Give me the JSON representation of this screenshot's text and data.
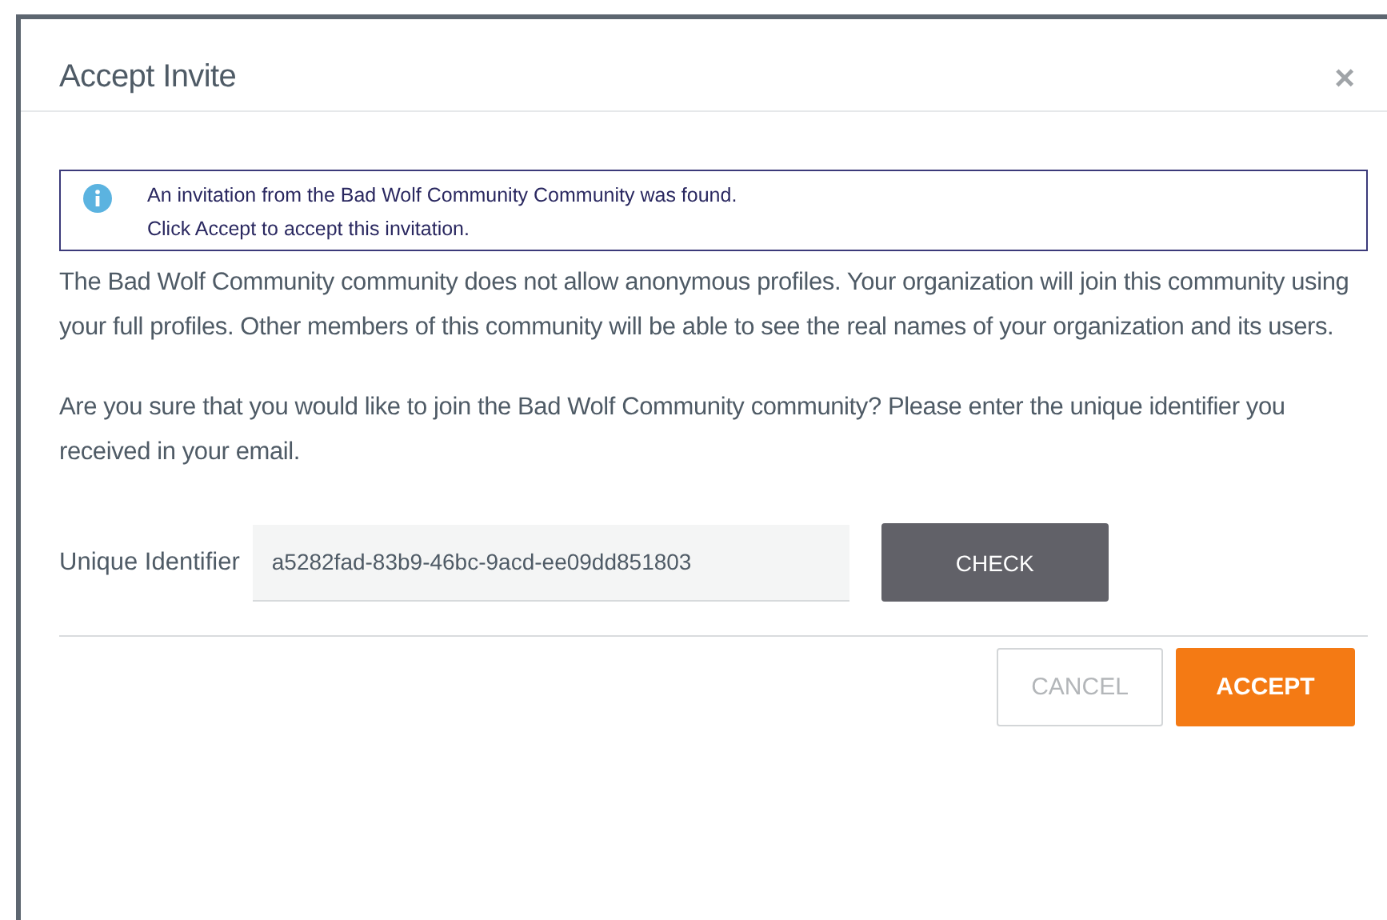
{
  "dialog": {
    "title": "Accept Invite",
    "close": "×"
  },
  "alert": {
    "lines": [
      "An invitation from the Bad Wolf Community Community was found.",
      "Click Accept to accept this invitation."
    ]
  },
  "paragraphs": [
    "The Bad Wolf Community community does not allow anonymous profiles. Your organization will join this community using your full profiles. Other members of this community will be able to see the real names of your organization and its users.",
    "Are you sure that you would like to join the Bad Wolf Community community? Please enter the unique identifier you received in your email."
  ],
  "identifier": {
    "label": "Unique Identifier",
    "value": "a5282fad-83b9-46bc-9acd-ee09dd851803",
    "button": "CHECK"
  },
  "buttons": [
    {
      "label": "CANCEL",
      "kind": "secondary"
    },
    {
      "label": "ACCEPT",
      "kind": "primary"
    }
  ]
}
